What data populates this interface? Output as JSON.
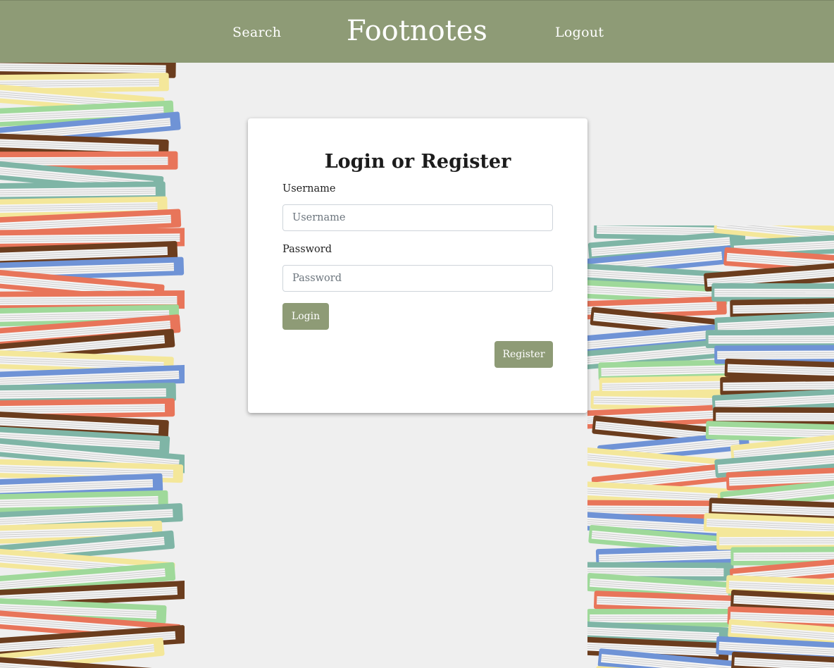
{
  "nav": {
    "search_label": "Search",
    "brand": "Footnotes",
    "logout_label": "Logout",
    "bar_color": "#8e9b76"
  },
  "form": {
    "title": "Login or Register",
    "username_label": "Username",
    "username_placeholder": "Username",
    "username_value": "",
    "password_label": "Password",
    "password_placeholder": "Password",
    "password_value": "",
    "login_label": "Login",
    "register_label": "Register"
  },
  "decor": {
    "background_image": "stacked-books-illustration",
    "book_colors": [
      "#6b3d1e",
      "#e8755a",
      "#6f93d6",
      "#f4e79a",
      "#9fd99a",
      "#7fb5a6",
      "#f4f4f4"
    ]
  }
}
